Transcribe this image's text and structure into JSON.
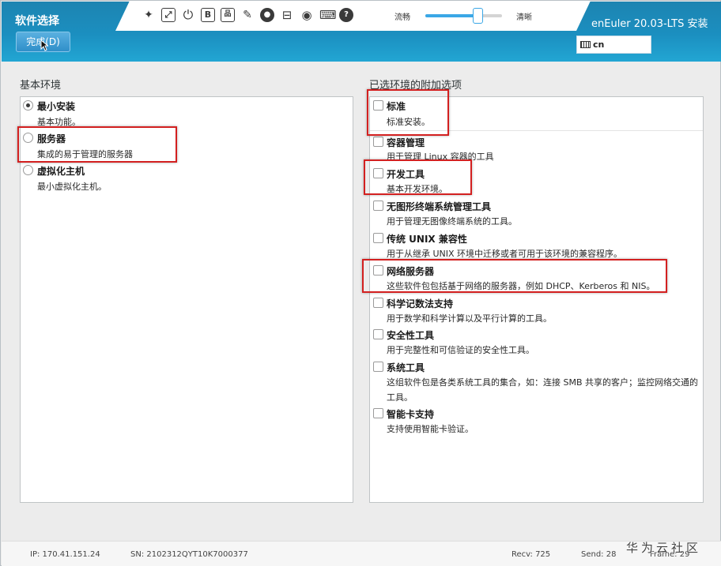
{
  "header": {
    "title": "软件选择",
    "done_label": "完成(D)",
    "product": "enEuler 20.03-LTS 安装",
    "keyboard": "cn",
    "quality_smooth": "流畅",
    "quality_clear": "清晰",
    "quality_level": 0.68,
    "toolbar_icons": [
      "pin-icon",
      "fullscreen-icon",
      "power-icon",
      "bold-b-icon",
      "network-icon",
      "mouse-icon",
      "record-icon",
      "document-icon",
      "camera-icon",
      "keyboard-icon",
      "help-icon"
    ]
  },
  "left": {
    "label": "基本环境",
    "items": [
      {
        "name": "最小安装",
        "desc": "基本功能。",
        "selected": true
      },
      {
        "name": "服务器",
        "desc": "集成的易于管理的服务器",
        "selected": false
      },
      {
        "name": "虚拟化主机",
        "desc": "最小虚拟化主机。",
        "selected": false
      }
    ]
  },
  "right": {
    "label": "已选环境的附加选项",
    "items": [
      {
        "name": "标准",
        "desc": "标准安装。"
      },
      {
        "name": "容器管理",
        "desc": "用于管理 Linux 容器的工具"
      },
      {
        "name": "开发工具",
        "desc": "基本开发环境。"
      },
      {
        "name": "无图形终端系统管理工具",
        "desc": "用于管理无图像终端系统的工具。"
      },
      {
        "name": "传统 UNIX 兼容性",
        "desc": "用于从继承 UNIX 环境中迁移或者可用于该环境的兼容程序。"
      },
      {
        "name": "网络服务器",
        "desc": "这些软件包包括基于网络的服务器，例如 DHCP、Kerberos 和 NIS。"
      },
      {
        "name": "科学记数法支持",
        "desc": "用于数学和科学计算以及平行计算的工具。"
      },
      {
        "name": "安全性工具",
        "desc": "用于完整性和可信验证的安全性工具。"
      },
      {
        "name": "系统工具",
        "desc": "这组软件包是各类系统工具的集合，如：连接 SMB 共享的客户；监控网络交通的工具。"
      },
      {
        "name": "智能卡支持",
        "desc": "支持使用智能卡验证。"
      }
    ]
  },
  "status": {
    "ip": "IP: 170.41.151.24",
    "sn": "SN: 2102312QYT10K7000377",
    "recv": "Recv: 725",
    "send": "Send: 28",
    "frame": "Frame: 29"
  },
  "watermark": "华为云社区"
}
